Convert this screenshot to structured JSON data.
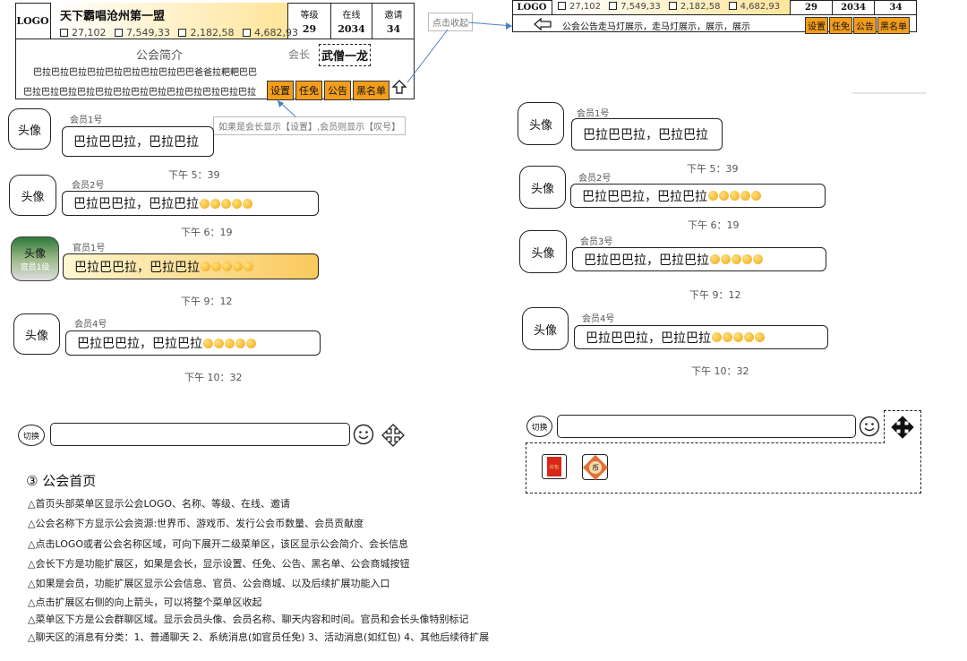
{
  "left_header": {
    "logo": "LOGO",
    "guild_name": "天下霸唱沧州第一盟",
    "resources": [
      "27,102",
      "7,549,33",
      "2,182,58",
      "4,682,93"
    ],
    "level_label": "等级",
    "level_value": "29",
    "online_label": "在线",
    "online_value": "2034",
    "invite_label": "邀请",
    "invite_value": "34",
    "intro_title": "公会简介",
    "intro_line1": "巴拉巴拉巴拉巴拉巴拉巴拉巴拉巴拉巴巴爸爸拉粑粑巴巴",
    "intro_line2": "巴拉巴拉巴拉巴拉巴拉巴拉巴拉巴拉巴拉巴拉巴拉巴拉巴拉",
    "leader_label": "会长",
    "leader_name": "武僧一龙",
    "buttons": [
      "设置",
      "任免",
      "公告",
      "黑名单"
    ]
  },
  "annotations": {
    "collapse_note": "点击收起",
    "leader_note": "如果是会长显示【设置】,会员则显示【叹号】"
  },
  "right_header": {
    "logo": "LOGO",
    "resources": [
      "27,102",
      "7,549,33",
      "2,182,58",
      "4,682,93"
    ],
    "level_value": "29",
    "online_value": "2034",
    "invite_value": "34",
    "marquee": "公会公告走马灯展示，走马灯展示，展示，展示",
    "buttons": [
      "设置",
      "任免",
      "公告",
      "黑名单"
    ]
  },
  "left_chat": {
    "avatar_label": "头像",
    "officer_label": "官员1级",
    "messages": [
      {
        "name": "会员1号",
        "text": "巴拉巴巴拉，巴拉巴拉",
        "time": "下午 5：39"
      },
      {
        "name": "会员2号",
        "text": "巴拉巴巴拉，巴拉巴拉",
        "time": "下午 6：19"
      },
      {
        "name": "官员1号",
        "text": "巴拉巴巴拉，巴拉巴拉",
        "time": "下午 9：12"
      },
      {
        "name": "会员4号",
        "text": "巴拉巴巴拉，巴拉巴拉",
        "time": "下午 10：32"
      }
    ],
    "switch_label": "切换"
  },
  "right_chat": {
    "avatar_label": "头像",
    "messages": [
      {
        "name": "会员1号",
        "text": "巴拉巴巴拉，巴拉巴拉",
        "time": "下午 5：39"
      },
      {
        "name": "会员2号",
        "text": "巴拉巴巴拉，巴拉巴拉",
        "time": "下午 6：19"
      },
      {
        "name": "会员3号",
        "text": "巴拉巴巴拉，巴拉巴拉",
        "time": "下午 9：12"
      },
      {
        "name": "会员4号",
        "text": "巴拉巴巴拉，巴拉巴拉",
        "time": "下午 10：32"
      }
    ],
    "switch_label": "切换",
    "redpacket_label": "红包",
    "coin_label": "币"
  },
  "notes": {
    "title": "③ 公会首页",
    "lines": [
      "△首页头部菜单区显示公会LOGO、名称、等级、在线、邀请",
      "△公会名称下方显示公会资源:世界币、游戏币、发行公会币数量、会员贡献度",
      "△点击LOGO或者公会名称区域，可向下展开二级菜单区，该区显示公会简介、会长信息",
      "△会长下方是功能扩展区，如果是会长，显示设置、任免、公告、黑名单、公会商城按钮",
      "△如果是会员，功能扩展区显示公会信息、官员、公会商城、以及后续扩展功能入口",
      "△点击扩展区右侧的向上箭头，可以将整个菜单区收起",
      "△菜单区下方是公会群聊区域。显示会员头像、会员名称、聊天内容和时间。官员和会长头像特别标记",
      "△聊天区的消息有分类：1、普通聊天 2、系统消息(如官员任免) 3、活动消息(如红包) 4、其他后续待扩展"
    ]
  }
}
